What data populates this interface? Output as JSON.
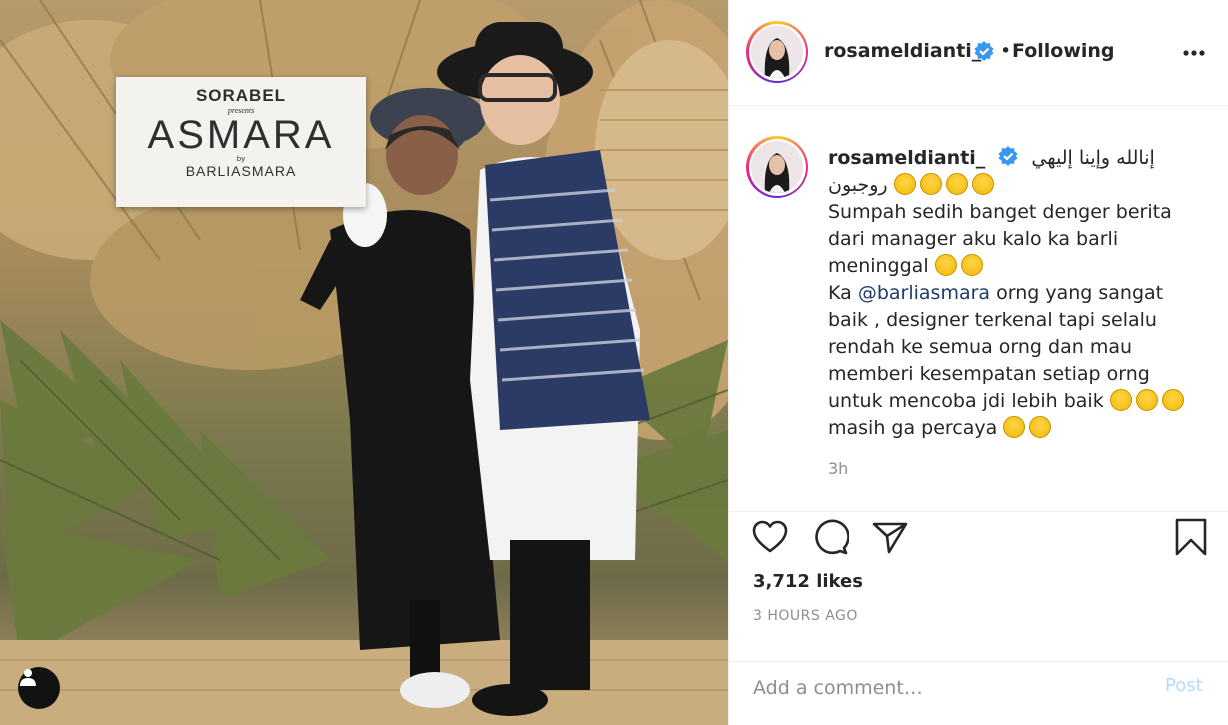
{
  "photo": {
    "sign": {
      "brand": "SORABEL",
      "presents": "presents",
      "title": "ASMARA",
      "by": "by",
      "designer": "BARLIASMARA"
    },
    "tag_icon": "user-tag-icon"
  },
  "header": {
    "username": "rosameldianti_",
    "verified_icon": "verified-badge-icon",
    "separator": "•",
    "follow_status": "Following",
    "more_icon": "more-options-icon"
  },
  "caption": {
    "username": "rosameldianti_",
    "arabic_line1": "إنالله وإينا إليهي",
    "arabic_line2": "روجبون",
    "text_line1": "Sumpah sedih banget denger berita",
    "text_line2": "dari manager aku kalo ka barli",
    "text_line3": "meninggal",
    "text_line4_prefix": "Ka",
    "mention": "@barliasmara",
    "text_line4_suffix": "orng yang sangat",
    "text_line5": "baik , designer terkenal tapi selalu",
    "text_line6": "rendah ke semua orng dan mau",
    "text_line7": "memberi kesempatan setiap orng",
    "text_line8": "untuk mencoba jdi lebih baik",
    "text_line9": "masih ga percaya",
    "time": "3h"
  },
  "actions": {
    "like_icon": "heart-icon",
    "comment_icon": "comment-icon",
    "share_icon": "share-icon",
    "save_icon": "bookmark-icon",
    "likes": "3,712 likes",
    "posted_ago": "3 HOURS AGO"
  },
  "comment_box": {
    "placeholder": "Add a comment…",
    "post_label": "Post"
  },
  "colors": {
    "accent_link": "#1f3b6a",
    "post_disabled": "#b3dbff",
    "verified": "#3897f0",
    "muted": "#8e8e8e"
  }
}
